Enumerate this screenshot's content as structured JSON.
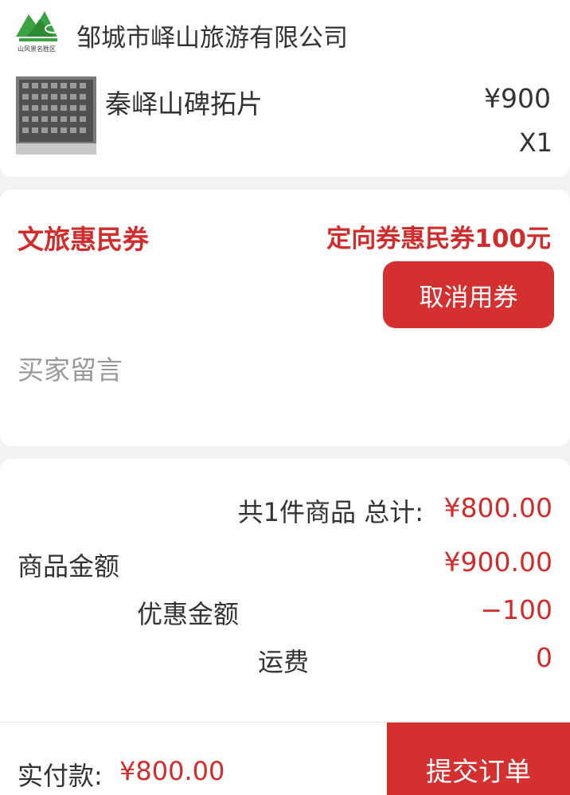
{
  "shop": {
    "name": "邹城市峄山旅游有限公司",
    "logo_icon": "mountain-logo-icon",
    "logo_caption": "山风景名胜区",
    "brand_color": "#3aa241"
  },
  "product": {
    "image_icon": "stone-rubbing-thumbnail",
    "name": "秦峄山碑拓片",
    "price": "¥900",
    "quantity": "X1"
  },
  "coupon": {
    "label": "文旅惠民券",
    "value": "定向券惠民券100元",
    "cancel_label": "取消用券",
    "accent_color": "#d43030"
  },
  "buyer_note": {
    "placeholder": "买家留言"
  },
  "summary": {
    "total_label": "共1件商品 总计:",
    "total_value": "¥800.00",
    "goods_label": "商品金额",
    "goods_value": "¥900.00",
    "discount_label": "优惠金额",
    "discount_value": "−100",
    "shipping_label": "运费",
    "shipping_value": "0"
  },
  "footer": {
    "paid_label": "实付款:",
    "paid_value": "¥800.00",
    "submit_label": "提交订单"
  }
}
